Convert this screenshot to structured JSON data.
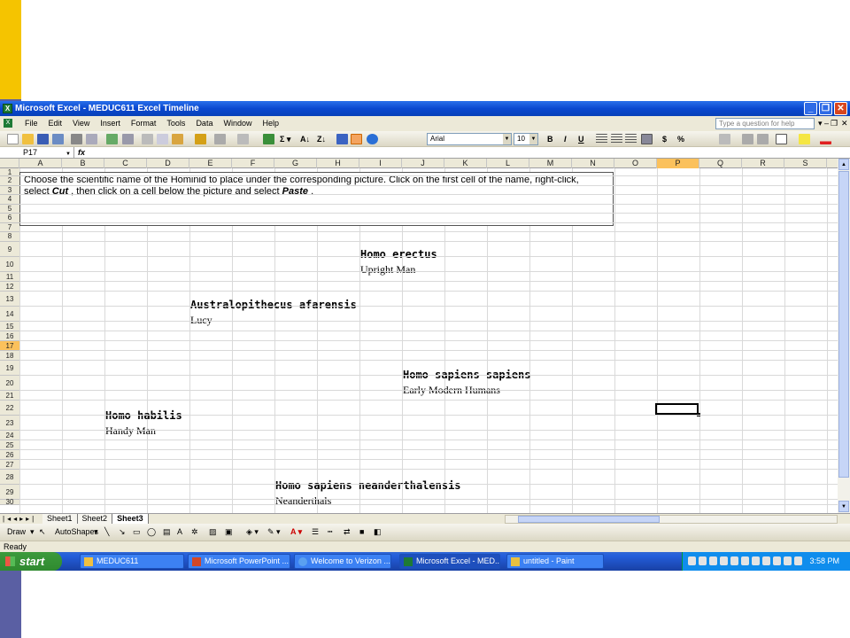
{
  "window": {
    "title": "Microsoft Excel - MEDUC611 Excel Timeline"
  },
  "menu": {
    "items": [
      "File",
      "Edit",
      "View",
      "Insert",
      "Format",
      "Tools",
      "Data",
      "Window",
      "Help"
    ],
    "help_placeholder": "Type a question for help"
  },
  "toolbar": {
    "font": "Arial",
    "size": "10",
    "bold": "B",
    "italic": "I",
    "underline": "U",
    "currency": "$",
    "percent": "%"
  },
  "formula": {
    "cell_ref": "P17",
    "fx": "fx"
  },
  "columns": [
    "A",
    "B",
    "C",
    "D",
    "E",
    "F",
    "G",
    "H",
    "I",
    "J",
    "K",
    "L",
    "M",
    "N",
    "O",
    "P",
    "Q",
    "R",
    "S"
  ],
  "selected_column": "P",
  "rows": [
    "1",
    "2",
    "3",
    "4",
    "5",
    "6",
    "7",
    "8",
    "9",
    "10",
    "11",
    "12",
    "13",
    "14",
    "15",
    "16",
    "17",
    "18",
    "19",
    "20",
    "21",
    "22",
    "23",
    "24",
    "25",
    "26",
    "27",
    "28",
    "29",
    "30"
  ],
  "selected_row": "17",
  "instructions": {
    "line1": "Choose the scientific name of the Hominid to place under the corresponding picture.  Click on the first cell of the name, right-click,",
    "line2_pre": "select ",
    "cut": "Cut",
    "line2_mid": " , then click on a cell below the picture and select ",
    "paste": "Paste",
    "line2_post": " ."
  },
  "hominids": [
    {
      "name": "Homo erectus",
      "common": "Upright Man"
    },
    {
      "name": "Australopithecus afarensis",
      "common": "Lucy"
    },
    {
      "name": "Homo sapiens sapiens",
      "common": "Early Modern Humans"
    },
    {
      "name": "Homo habilis",
      "common": "Handy Man"
    },
    {
      "name": "Homo sapiens neanderthalensis",
      "common": "Neanderthals"
    }
  ],
  "sheets": [
    "Sheet1",
    "Sheet2",
    "Sheet3"
  ],
  "active_sheet": "Sheet3",
  "drawbar": {
    "draw": "Draw",
    "autoshapes": "AutoShapes"
  },
  "status": "Ready",
  "taskbar": {
    "start": "start",
    "tasks": [
      "MEDUC611",
      "Microsoft PowerPoint ...",
      "Welcome to Verizon ...",
      "Microsoft Excel - MED...",
      "untitled - Paint"
    ],
    "time": "3:58 PM"
  }
}
